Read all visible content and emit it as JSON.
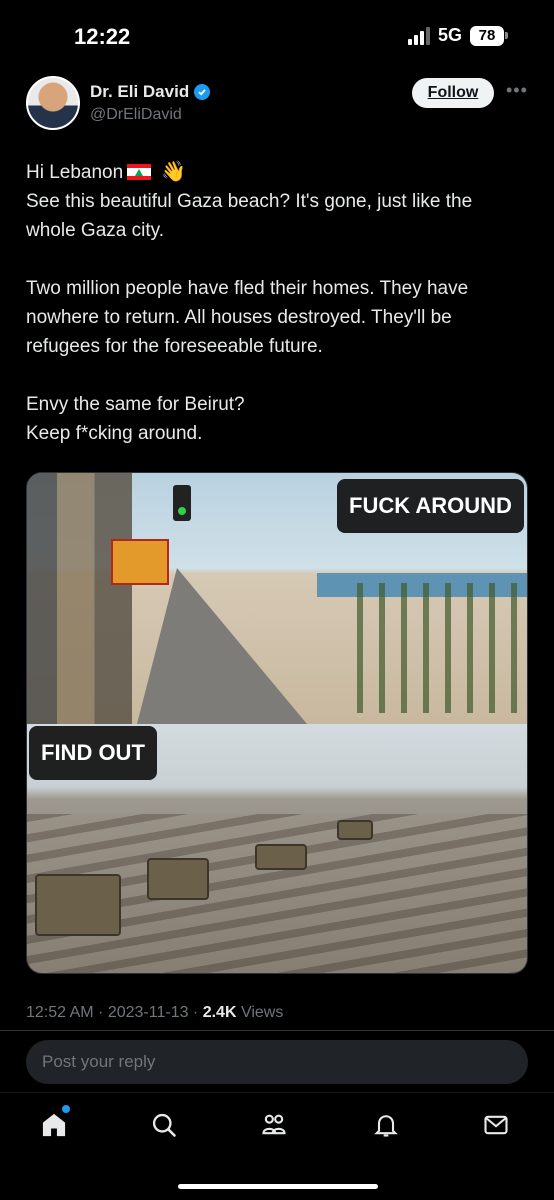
{
  "status_bar": {
    "time": "12:22",
    "network": "5G",
    "battery": "78"
  },
  "author": {
    "name": "Dr. Eli David",
    "handle": "@DrEliDavid",
    "follow_label": "Follow",
    "more_icon": "ellipsis-icon"
  },
  "tweet": {
    "p1_line1": "Hi Lebanon",
    "p1_line2": "See this beautiful Gaza beach? It's gone, just like the whole Gaza city.",
    "p2": "Two million people have fled their homes. They have nowhere to return. All houses destroyed. They'll be refugees for the foreseeable future.",
    "p3_line1": "Envy the same for Beirut?",
    "p3_line2": "Keep f*cking around."
  },
  "media": {
    "top_caption": "FUCK AROUND",
    "bottom_caption": "FIND OUT"
  },
  "meta": {
    "time": "12:52 AM",
    "date": "2023-11-13",
    "views_count": "2.4K",
    "views_label": "Views"
  },
  "reply": {
    "placeholder": "Post your reply"
  },
  "tabs": [
    "home-icon",
    "search-icon",
    "communities-icon",
    "notifications-icon",
    "messages-icon"
  ],
  "colors": {
    "accent": "#1d9bf0",
    "background": "#000000",
    "text": "#e7e9ea",
    "muted": "#71767b"
  }
}
